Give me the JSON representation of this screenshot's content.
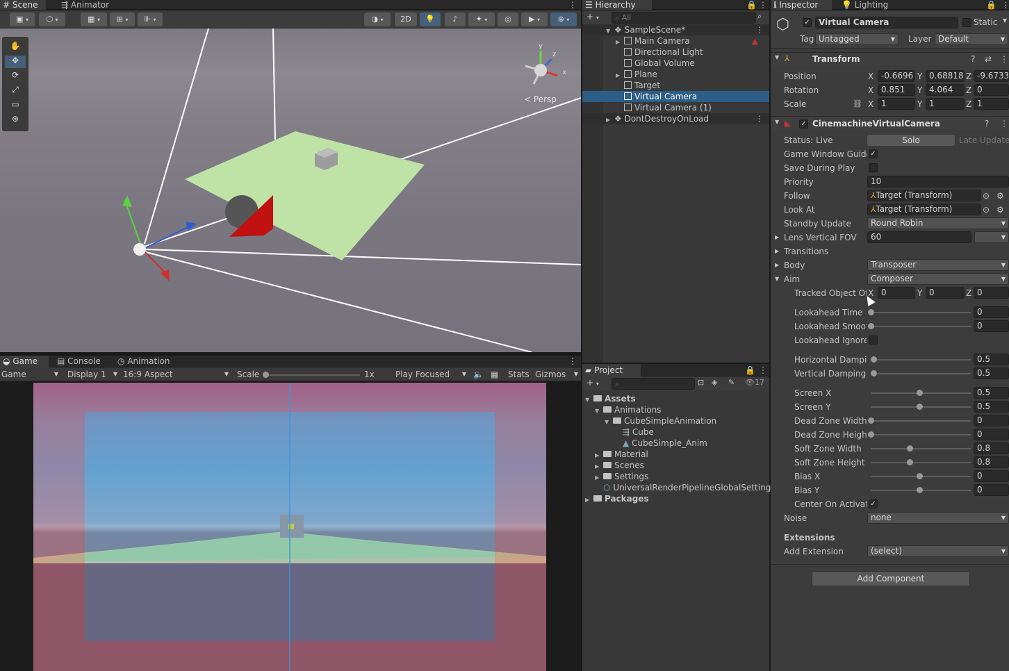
{
  "scene_panel": {
    "tabs": [
      {
        "label": "Scene"
      },
      {
        "label": "Animator"
      }
    ],
    "toolbar": {
      "mode_2d": "2D"
    },
    "persp_label": "Persp",
    "gizmo_axes": {
      "y": "y",
      "z": "z",
      "x": "x"
    }
  },
  "game_panel": {
    "tabs": [
      {
        "label": "Game"
      },
      {
        "label": "Console"
      },
      {
        "label": "Animation"
      }
    ],
    "display_mode": "Game",
    "display": "Display 1",
    "aspect": "16:9 Aspect",
    "scale_label": "Scale",
    "scale_value": "1x",
    "play_mode": "Play Focused",
    "stats": "Stats",
    "gizmos": "Gizmos"
  },
  "hierarchy": {
    "tab": "Hierarchy",
    "search_placeholder": "All",
    "items": [
      {
        "label": "SampleScene*"
      },
      {
        "label": "Main Camera"
      },
      {
        "label": "Directional Light"
      },
      {
        "label": "Global Volume"
      },
      {
        "label": "Plane"
      },
      {
        "label": "Target"
      },
      {
        "label": "Virtual Camera"
      },
      {
        "label": "Virtual Camera (1)"
      },
      {
        "label": "DontDestroyOnLoad"
      }
    ]
  },
  "project": {
    "tab": "Project",
    "hidden_count": "17",
    "items": [
      {
        "label": "Assets"
      },
      {
        "label": "Animations"
      },
      {
        "label": "CubeSimpleAnimation"
      },
      {
        "label": "Cube"
      },
      {
        "label": "CubeSimple_Anim"
      },
      {
        "label": "Material"
      },
      {
        "label": "Scenes"
      },
      {
        "label": "Settings"
      },
      {
        "label": "UniversalRenderPipelineGlobalSettings"
      },
      {
        "label": "Packages"
      }
    ]
  },
  "inspector": {
    "tabs": [
      {
        "label": "Inspector"
      },
      {
        "label": "Lighting"
      }
    ],
    "object_name": "Virtual Camera",
    "static_label": "Static",
    "tag_label": "Tag",
    "tag_value": "Untagged",
    "layer_label": "Layer",
    "layer_value": "Default",
    "transform": {
      "title": "Transform",
      "position": {
        "label": "Position",
        "x": "-0.6696",
        "y": "0.68818",
        "z": "-9.6733"
      },
      "rotation": {
        "label": "Rotation",
        "x": "0.851",
        "y": "4.064",
        "z": "0"
      },
      "scale": {
        "label": "Scale",
        "x": "1",
        "y": "1",
        "z": "1"
      }
    },
    "cinemachine": {
      "title": "CinemachineVirtualCamera",
      "status": "Status: Live",
      "solo": "Solo",
      "late_update": "Late Update",
      "game_window_guides": "Game Window Guides",
      "save_during_play": "Save During Play",
      "priority_label": "Priority",
      "priority_value": "10",
      "follow_label": "Follow",
      "follow_value": "Target (Transform)",
      "lookat_label": "Look At",
      "lookat_value": "Target (Transform)",
      "standby_label": "Standby Update",
      "standby_value": "Round Robin",
      "fov_label": "Lens Vertical FOV",
      "fov_value": "60",
      "transitions": "Transitions",
      "body_label": "Body",
      "body_value": "Transposer",
      "aim_label": "Aim",
      "aim_value": "Composer",
      "tracked_label": "Tracked Object Offset",
      "tracked": {
        "x": "0",
        "y": "0",
        "z": "0"
      },
      "sliders": [
        {
          "label": "Lookahead Time",
          "value": "0",
          "pos": 0
        },
        {
          "label": "Lookahead Smoothing",
          "value": "0",
          "pos": 0
        },
        {
          "label": "Horizontal Damping",
          "value": "0.5",
          "pos": 0.025
        },
        {
          "label": "Vertical Damping",
          "value": "0.5",
          "pos": 0.025
        },
        {
          "label": "Screen X",
          "value": "0.5",
          "pos": 0.5
        },
        {
          "label": "Screen Y",
          "value": "0.5",
          "pos": 0.5
        },
        {
          "label": "Dead Zone Width",
          "value": "0",
          "pos": 0
        },
        {
          "label": "Dead Zone Height",
          "value": "0",
          "pos": 0
        },
        {
          "label": "Soft Zone Width",
          "value": "0.8",
          "pos": 0.4
        },
        {
          "label": "Soft Zone Height",
          "value": "0.8",
          "pos": 0.4
        },
        {
          "label": "Bias X",
          "value": "0",
          "pos": 0.5
        },
        {
          "label": "Bias Y",
          "value": "0",
          "pos": 0.5
        }
      ],
      "lookahead_ignore": "Lookahead Ignore Y",
      "center_on_activate": "Center On Activate",
      "noise_label": "Noise",
      "noise_value": "none",
      "extensions": "Extensions",
      "add_extension_label": "Add Extension",
      "add_extension_value": "(select)"
    },
    "add_component": "Add Component"
  },
  "colors": {
    "selection": "#2c5d87",
    "panel": "#383838",
    "dark": "#282828"
  }
}
